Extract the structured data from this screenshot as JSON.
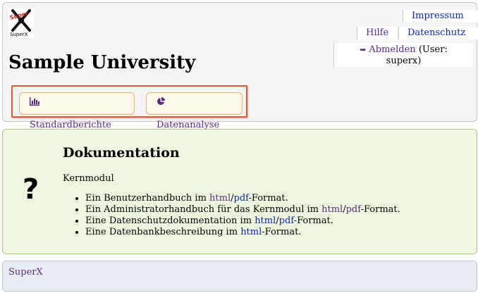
{
  "header": {
    "logo_text": "SuperX",
    "site_title": "Sample University",
    "links": {
      "impressum": "Impressum",
      "hilfe": "Hilfe",
      "datenschutz": "Datenschutz"
    },
    "user": {
      "logout_label": "Abmelden",
      "user_info_prefix": "(User:",
      "username_suffix": "superx)"
    },
    "menu": {
      "standardberichte": "Standardberichte",
      "datenanalyse": "Datenanalyse"
    }
  },
  "doc": {
    "title": "Dokumentation",
    "subtitle": "Kernmodul",
    "items": [
      {
        "before": "Ein Benutzerhandbuch im ",
        "html": "html",
        "sep": "/",
        "pdf": "pdf",
        "after": "-Format."
      },
      {
        "before": "Ein Administratorhandbuch für das Kernmodul im ",
        "html": "html",
        "sep": "/",
        "pdf": "pdf",
        "after": "-Format."
      },
      {
        "before": "Eine Datenschutzdokumentation im ",
        "html": "html",
        "sep": "/",
        "pdf": "pdf",
        "after": "-Format."
      },
      {
        "before": "Eine Datenbankbeschreibung im ",
        "html": "html",
        "after": "-Format."
      }
    ]
  },
  "footer": {
    "link": "SuperX"
  },
  "colors": {
    "visited_link": "#5b2a86",
    "link": "#0a1fc4",
    "highlight_border": "#e4572e",
    "doc_background": "#eef6dd",
    "footer_background": "#e8ecf4"
  },
  "icons": {
    "logo": "superx-logo-icon",
    "logout": "logout-icon",
    "standardberichte": "bar-chart-icon",
    "datenanalyse": "pie-chart-icon",
    "doc": "question-mark-icon"
  }
}
